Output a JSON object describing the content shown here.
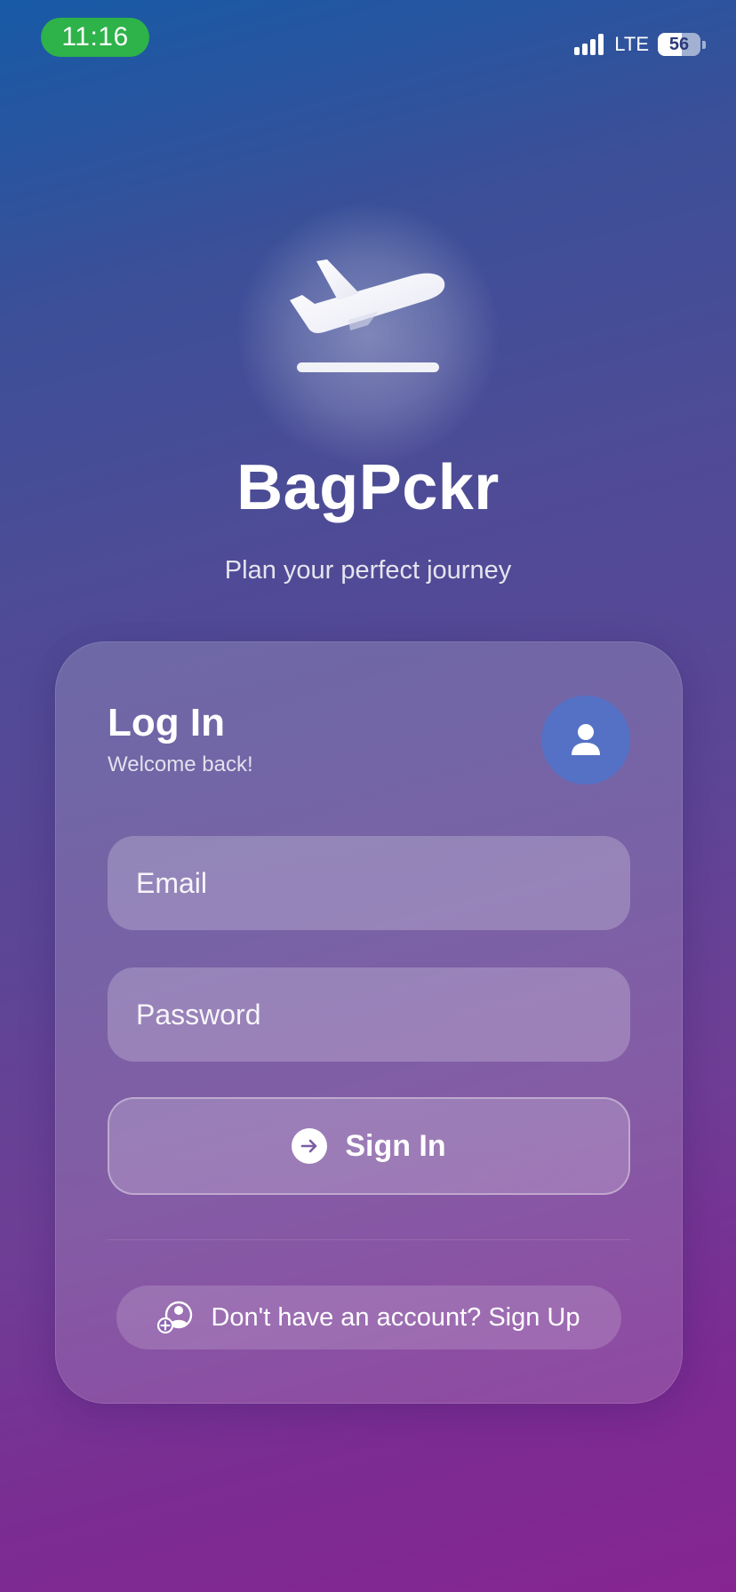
{
  "status_bar": {
    "time": "11:16",
    "network": "LTE",
    "battery_level": "56",
    "battery_fraction": 0.56
  },
  "app": {
    "name": "BagPckr",
    "tagline": "Plan your perfect journey",
    "hero_icon": "airplane-takeoff-icon"
  },
  "login": {
    "title": "Log In",
    "subtitle": "Welcome back!",
    "avatar_icon": "user-icon",
    "email_placeholder": "Email",
    "password_placeholder": "Password",
    "signin_label": "Sign In",
    "signin_icon": "arrow-right-circle-icon",
    "signup_label": "Don't have an account? Sign Up",
    "signup_icon": "add-user-icon"
  },
  "colors": {
    "status_time_bg": "#2eb24a",
    "avatar_bg": "#5471c5",
    "gradient_top": "#175aa6",
    "gradient_bottom": "#862592"
  }
}
